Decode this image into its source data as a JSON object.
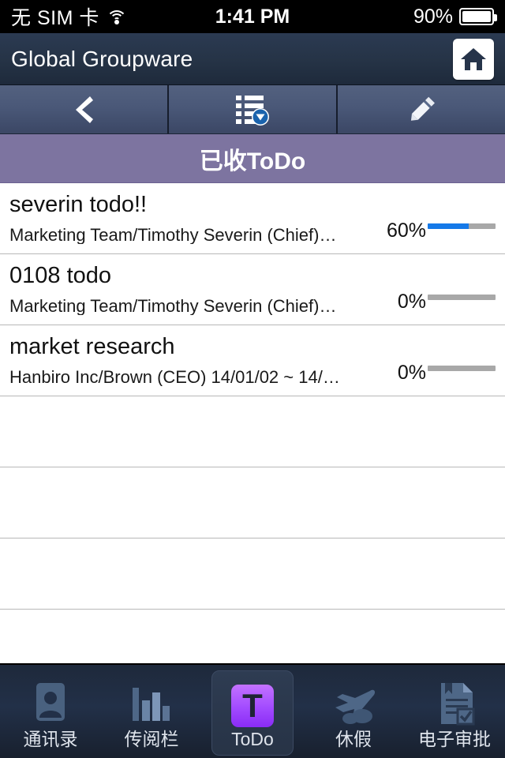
{
  "statusbar": {
    "carrier": "无 SIM 卡",
    "wifi_icon": "wifi-icon",
    "time": "1:41 PM",
    "battery_pct": "90%",
    "battery_icon": "battery-icon",
    "battery_level": 90
  },
  "titlebar": {
    "title": "Global Groupware",
    "home_icon": "home-icon"
  },
  "toolbar": {
    "buttons": [
      {
        "name": "back-button",
        "icon": "chevron-left-icon"
      },
      {
        "name": "list-filter-button",
        "icon": "list-dropdown-icon"
      },
      {
        "name": "compose-button",
        "icon": "pencil-icon"
      }
    ]
  },
  "section": {
    "title": "已收ToDo",
    "color": "#7d74a0"
  },
  "list": {
    "items": [
      {
        "title": "severin todo!!",
        "subtitle": "Marketing Team/Timothy Severin (Chief)…",
        "percent_label": "60%",
        "percent": 60
      },
      {
        "title": "0108 todo",
        "subtitle": "Marketing Team/Timothy Severin (Chief)…",
        "percent_label": "0%",
        "percent": 0
      },
      {
        "title": "market research",
        "subtitle": "Hanbiro Inc/Brown (CEO) 14/01/02 ~ 14/…",
        "percent_label": "0%",
        "percent": 0
      }
    ],
    "empty_rows": 4,
    "progress_fill_color": "#1579e8",
    "progress_track_color": "#a8a8a8"
  },
  "tabbar": {
    "tabs": [
      {
        "label": "通讯录",
        "icon": "contacts-icon",
        "active": false
      },
      {
        "label": "传阅栏",
        "icon": "bar-chart-icon",
        "active": false
      },
      {
        "label": "ToDo",
        "icon": "todo-icon",
        "active": true
      },
      {
        "label": "休假",
        "icon": "airplane-icon",
        "active": false
      },
      {
        "label": "电子审批",
        "icon": "document-approval-icon",
        "active": false
      }
    ]
  }
}
